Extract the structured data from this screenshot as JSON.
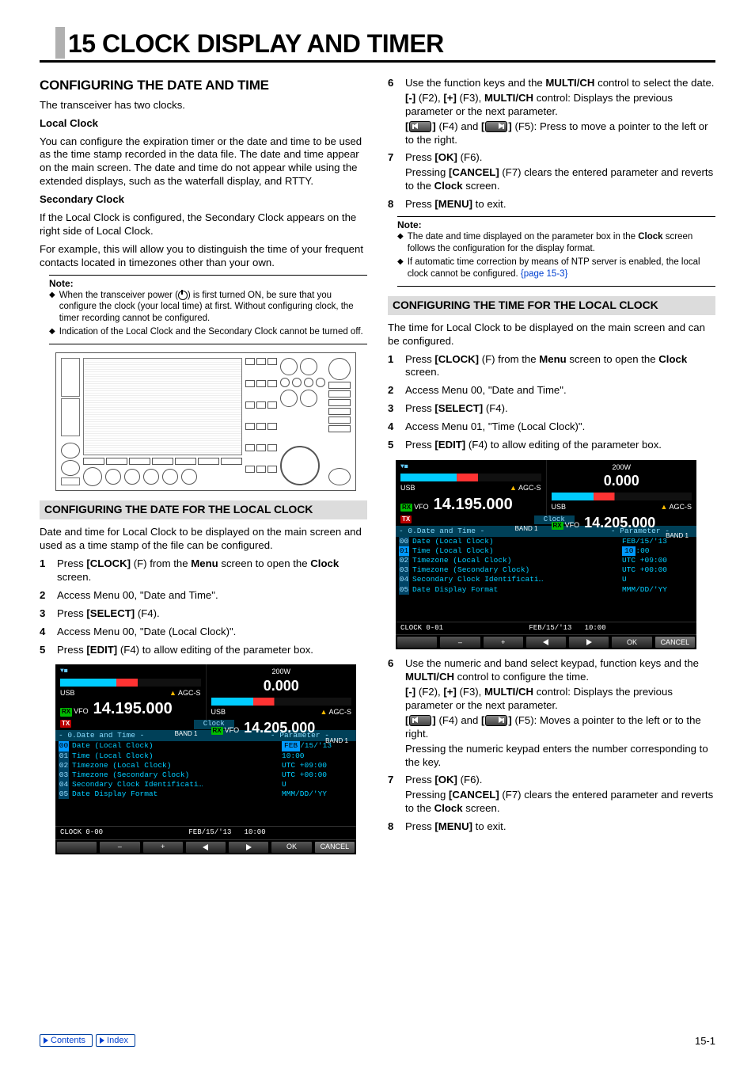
{
  "chapter": {
    "number": "15",
    "title": "CLOCK DISPLAY AND TIMER"
  },
  "left": {
    "section_title": "CONFIGURING THE DATE AND TIME",
    "intro": "The transceiver has two clocks.",
    "local_clock_h": "Local Clock",
    "local_clock_p": "You can configure the expiration timer or the date and time to be used as the time stamp recorded in the data file. The date and time appear on the main screen. The date and time do not appear while using the extended displays, such as the waterfall display, and RTTY.",
    "secondary_clock_h": "Secondary Clock",
    "secondary_p1": "If the Local Clock is configured, the Secondary Clock appears on the right side of Local Clock.",
    "secondary_p2": "For example, this will allow you to distinguish the time of your frequent contacts located in timezones other than your own.",
    "note_label": "Note:",
    "note1a": "When the transceiver power (",
    "note1b": ") is first turned ON, be sure that you configure the clock (your local time) at first. Without configuring clock, the timer recording cannot be configured.",
    "note2": "Indication of the Local Clock and the Secondary Clock cannot be turned off.",
    "sub_date": "CONFIGURING THE DATE FOR THE LOCAL CLOCK",
    "sub_date_p": "Date and time for Local Clock to be displayed on the main screen and used as a time stamp of the file can be configured.",
    "s1a": "Press ",
    "s1b": "[CLOCK]",
    "s1c": " (F) from the ",
    "s1d": "Menu",
    "s1e": " screen to open the ",
    "s1f": "Clock",
    "s1g": " screen.",
    "s2": "Access Menu 00, \"Date and Time\".",
    "s3a": "Press ",
    "s3b": "[SELECT]",
    "s3c": " (F4).",
    "s4": "Access Menu 00, \"Date (Local Clock)\".",
    "s5a": "Press ",
    "s5b": "[EDIT]",
    "s5c": " (F4) to allow editing of the parameter box."
  },
  "right": {
    "s6a": "Use the function keys and the ",
    "s6b": "MULTI/CH",
    "s6c": " control to select the date.",
    "s6d": "[-]",
    "s6e": " (F2), ",
    "s6f": "[+]",
    "s6g": " (F3), ",
    "s6h": "MULTI/CH",
    "s6i": " control: Displays the previous parameter or the next parameter.",
    "s6j": "[",
    "s6k": "]",
    "s6l": " (F4) and ",
    "s6m": "[",
    "s6n": "]",
    "s6o": " (F5): Press to move a pointer to the left or to the right.",
    "s7a": "Press ",
    "s7b": "[OK]",
    "s7c": " (F6).",
    "s7d": "Pressing ",
    "s7e": "[CANCEL]",
    "s7f": " (F7) clears the entered parameter and reverts to the ",
    "s7g": "Clock",
    "s7h": " screen.",
    "s8a": "Press ",
    "s8b": "[MENU]",
    "s8c": " to exit.",
    "note_label": "Note:",
    "rnote1a": "The date and time displayed on the parameter box in the ",
    "rnote1b": "Clock",
    "rnote1c": " screen follows the configuration for the display format.",
    "rnote2a": "If automatic time correction by means of NTP server is enabled, the local clock cannot be configured. ",
    "rnote2b": "{page 15-3}",
    "sub_time": "CONFIGURING THE TIME FOR THE LOCAL CLOCK",
    "sub_time_p": "The time for Local Clock to be displayed on the main screen and can be configured.",
    "t1a": "Press ",
    "t1b": "[CLOCK]",
    "t1c": " (F) from the ",
    "t1d": "Menu",
    "t1e": " screen to open the ",
    "t1f": "Clock",
    "t1g": " screen.",
    "t2": "Access Menu 00, \"Date and Time\".",
    "t3a": "Press ",
    "t3b": "[SELECT]",
    "t3c": " (F4).",
    "t4": "Access Menu 01, \"Time (Local Clock)\".",
    "t5a": "Press ",
    "t5b": "[EDIT]",
    "t5c": " (F4) to allow editing of the parameter box.",
    "u6a": "Use the numeric and band select keypad, function keys and the ",
    "u6b": "MULTI/CH",
    "u6c": " control to configure the time.",
    "u6d": "[-]",
    "u6e": " (F2), ",
    "u6f": "[+]",
    "u6g": " (F3), ",
    "u6h": "MULTI/CH",
    "u6i": " control: Displays the previous parameter or the next parameter.",
    "u6j": "[",
    "u6k": "]",
    "u6l": " (F4) and ",
    "u6m": "[",
    "u6n": "]",
    "u6o": " (F5): Moves a pointer to the left or to the right.",
    "u6p": "Pressing the numeric keypad enters the number corresponding to the key.",
    "u7a": "Press ",
    "u7b": "[OK]",
    "u7c": " (F6).",
    "u7d": "Pressing ",
    "u7e": "[CANCEL]",
    "u7f": " (F7) clears the entered parameter and reverts to the ",
    "u7g": "Clock",
    "u7h": " screen.",
    "u8a": "Press ",
    "u8b": "[MENU]",
    "u8c": " to exit."
  },
  "screen": {
    "power": "200W",
    "usb": "USB",
    "rx": "RX",
    "tx": "TX",
    "vfo": "VFO",
    "agc": "AGC-S",
    "freq_main": "14.195.000",
    "freq_sub": "14.205.000",
    "band": "BAND 1",
    "clock_tab": "Clock",
    "list_head": "- 0.Date and Time -",
    "param_head": "- Parameter -",
    "rows": [
      {
        "n": "00",
        "l": "Date (Local Clock)",
        "v": "FEB/15/'13"
      },
      {
        "n": "01",
        "l": "Time (Local Clock)",
        "v": "10:00"
      },
      {
        "n": "02",
        "l": "Timezone (Local Clock)",
        "v": "UTC +09:00"
      },
      {
        "n": "03",
        "l": "Timezone (Secondary Clock)",
        "v": "UTC +00:00"
      },
      {
        "n": "04",
        "l": "Secondary Clock Identificati…",
        "v": "U"
      },
      {
        "n": "05",
        "l": "Date Display Format",
        "v": "MMM/DD/'YY"
      }
    ],
    "status_left_a": "CLOCK 0-00",
    "status_left_b": "CLOCK 0-01",
    "status_center": "FEB/15/'13",
    "status_right": "10:00",
    "btn_minus": "–",
    "btn_plus": "+",
    "btn_ok": "OK",
    "btn_cancel": "CANCEL"
  },
  "footer": {
    "contents": "Contents",
    "index": "Index",
    "page": "15-1"
  }
}
